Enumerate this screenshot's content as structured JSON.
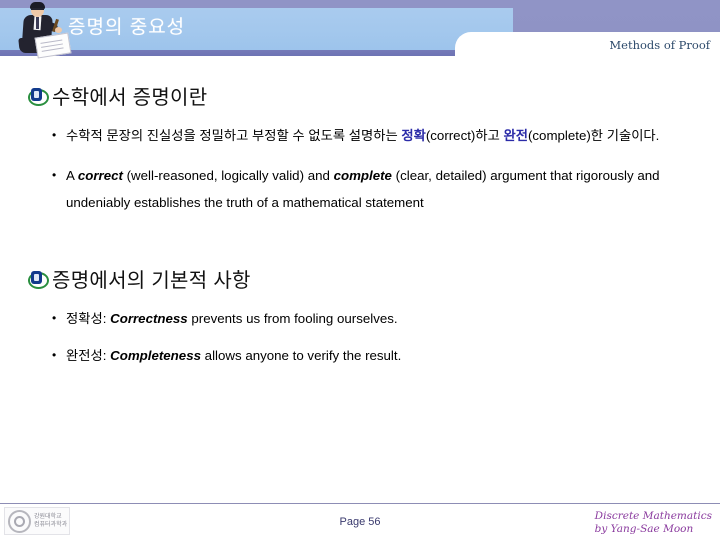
{
  "slide": {
    "header": {
      "title": "증명의 중요성",
      "subtitle": "Methods of Proof",
      "figure_icon": "person-writing-illustration",
      "bar_color": "#a4c8ed",
      "background_color": "#8f93c5"
    },
    "sections": [
      {
        "icon": "globe-bullet-icon",
        "title": "수학에서 증명이란",
        "bullets": [
          {
            "parts": [
              {
                "text": "수학적 문장의 진실성을 정밀하고 부정할 수 없도록 설명하는 ",
                "style": "normal"
              },
              {
                "text": "정확",
                "style": "kor-bold-blue"
              },
              {
                "text": "(correct)하고 ",
                "style": "normal"
              },
              {
                "text": "완전",
                "style": "kor-bold-blue"
              },
              {
                "text": "(complete)한 기술이다.",
                "style": "normal"
              }
            ]
          },
          {
            "parts": [
              {
                "text": "A ",
                "style": "normal"
              },
              {
                "text": "correct",
                "style": "emph"
              },
              {
                "text": " (well-reasoned, logically valid) and ",
                "style": "normal"
              },
              {
                "text": "complete",
                "style": "emph"
              },
              {
                "text": " (clear, detailed) argument that rigorously and undeniably establishes the truth of a mathematical statement",
                "style": "normal"
              }
            ]
          }
        ]
      },
      {
        "icon": "globe-bullet-icon",
        "title": "증명에서의 기본적 사항",
        "bullets": [
          {
            "parts": [
              {
                "text": "정확성: ",
                "style": "normal"
              },
              {
                "text": "Correctness",
                "style": "emph"
              },
              {
                "text": " prevents us from fooling ourselves.",
                "style": "normal"
              }
            ]
          },
          {
            "parts": [
              {
                "text": "완전성: ",
                "style": "normal"
              },
              {
                "text": "Completeness",
                "style": "emph"
              },
              {
                "text": " allows anyone to verify the result.",
                "style": "normal"
              }
            ]
          }
        ]
      }
    ],
    "footer": {
      "logo_icon": "university-seal-logo",
      "logo_line1": "강원대학교",
      "logo_line2": "컴퓨터과학과",
      "page_label": "Page 56",
      "credit_line1": "Discrete Mathematics",
      "credit_line2": "by Yang-Sae Moon",
      "credit_color": "#8a3a9e"
    }
  }
}
